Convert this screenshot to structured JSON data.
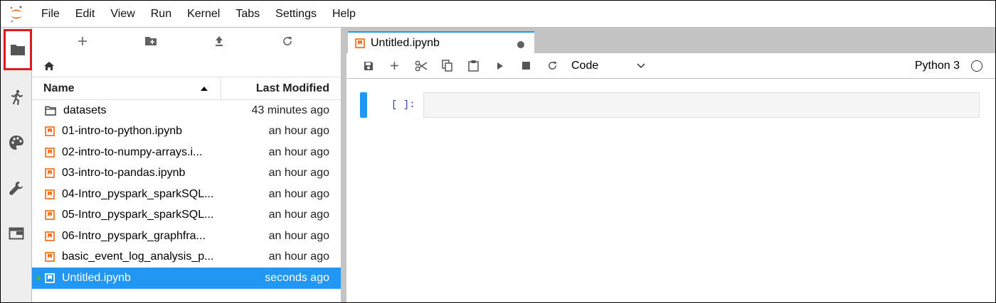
{
  "menu": [
    "File",
    "Edit",
    "View",
    "Run",
    "Kernel",
    "Tabs",
    "Settings",
    "Help"
  ],
  "activity_bar": [
    {
      "icon": "folder-icon",
      "active": true
    },
    {
      "icon": "running-icon",
      "active": false
    },
    {
      "icon": "palette-icon",
      "active": false
    },
    {
      "icon": "wrench-icon",
      "active": false
    },
    {
      "icon": "tabs-icon",
      "active": false
    }
  ],
  "file_browser": {
    "toolbar_icons": [
      "plus-icon",
      "new-folder-icon",
      "upload-icon",
      "refresh-icon"
    ],
    "breadcrumb_icon": "home-icon",
    "header": {
      "name": "Name",
      "modified": "Last Modified"
    },
    "rows": [
      {
        "name": "datasets",
        "modified": "43 minutes ago",
        "type": "folder"
      },
      {
        "name": "01-intro-to-python.ipynb",
        "modified": "an hour ago",
        "type": "notebook"
      },
      {
        "name": "02-intro-to-numpy-arrays.i...",
        "modified": "an hour ago",
        "type": "notebook"
      },
      {
        "name": "03-intro-to-pandas.ipynb",
        "modified": "an hour ago",
        "type": "notebook"
      },
      {
        "name": "04-Intro_pyspark_sparkSQL...",
        "modified": "an hour ago",
        "type": "notebook"
      },
      {
        "name": "05-Intro_pyspark_sparkSQL...",
        "modified": "an hour ago",
        "type": "notebook"
      },
      {
        "name": "06-Intro_pyspark_graphfra...",
        "modified": "an hour ago",
        "type": "notebook"
      },
      {
        "name": "basic_event_log_analysis_p...",
        "modified": "an hour ago",
        "type": "notebook"
      },
      {
        "name": "Untitled.ipynb",
        "modified": "seconds ago",
        "type": "notebook",
        "selected": true,
        "running": true
      }
    ]
  },
  "notebook": {
    "tab_title": "Untitled.ipynb",
    "cell_type": "Code",
    "kernel_name": "Python 3",
    "cell_prompt": "[ ]:"
  },
  "colors": {
    "accent": "#2196f3",
    "notebook_orange": "#f37726",
    "highlight_red": "#e0191f"
  }
}
